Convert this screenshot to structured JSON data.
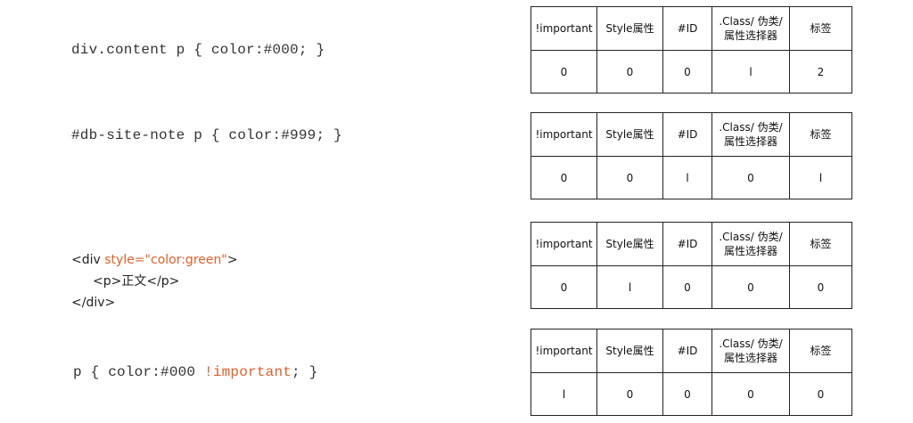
{
  "headers": [
    "!important",
    "Style属性",
    "#ID",
    ".Class/ 伪类/ 属性选择器",
    "标签"
  ],
  "examples": [
    {
      "code": "div.content p { color:#000; }",
      "values": [
        "0",
        "0",
        "0",
        "l",
        "2"
      ]
    },
    {
      "code": "#db-site-note p { color:#999; }",
      "values": [
        "0",
        "0",
        "l",
        "0",
        "l"
      ]
    },
    {
      "html_open_start": "<div ",
      "html_attr": "style=\"color:green\"",
      "html_open_end": ">",
      "html_inner": "<p>正文</p>",
      "html_close": "</div>",
      "values": [
        "0",
        "l",
        "0",
        "0",
        "0"
      ]
    },
    {
      "code_start": "p { color:#000 ",
      "code_important": "!important",
      "code_end": "; }",
      "values": [
        "l",
        "0",
        "0",
        "0",
        "0"
      ]
    }
  ]
}
